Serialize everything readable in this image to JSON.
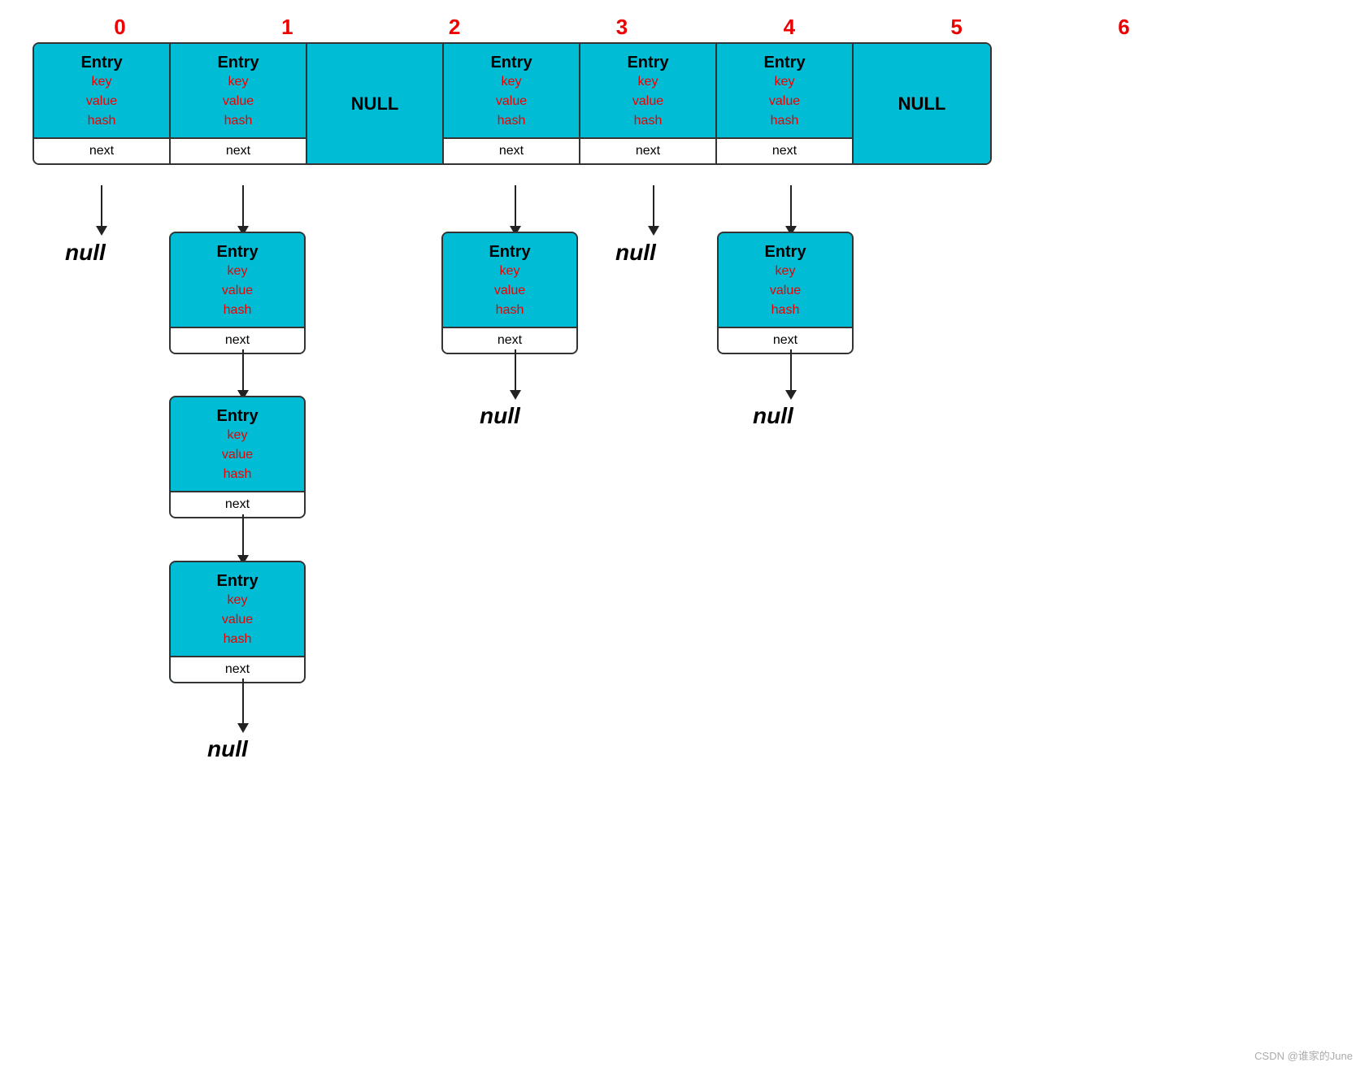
{
  "indices": [
    "0",
    "1",
    "2",
    "3",
    "4",
    "5",
    "6"
  ],
  "indexColors": "#dd0000",
  "entryLabel": "Entry",
  "fields": [
    "key",
    "value",
    "hash"
  ],
  "nextLabel": "next",
  "nullLabel": "NULL",
  "nullText": "null",
  "watermark": "CSDN @谁家的June",
  "columns": [
    {
      "type": "entry"
    },
    {
      "type": "entry"
    },
    {
      "type": "null"
    },
    {
      "type": "entry"
    },
    {
      "type": "entry"
    },
    {
      "type": "entry"
    },
    {
      "type": "null"
    }
  ],
  "chain1": {
    "col": 0,
    "count": 1,
    "isNull": true
  },
  "chain2": {
    "col": 1,
    "count": 3
  },
  "chain3": {
    "col": 3,
    "count": 1,
    "isNull": true
  },
  "chain4": {
    "col": 4,
    "count": 1,
    "isNull": true
  },
  "chain5": {
    "col": 5,
    "count": 1,
    "isNull": true
  }
}
